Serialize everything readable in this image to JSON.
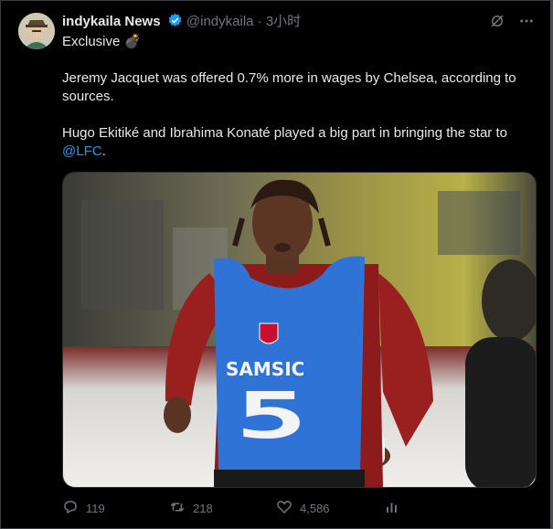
{
  "post": {
    "author_name": "indykaila News",
    "handle": "@indykaila",
    "separator": "·",
    "time": "3小时",
    "lines": [
      "Exclusive 💣",
      "Jeremy Jacquet was offered 0.7% more in wages by Chelsea, according to",
      "sources.",
      "Hugo Ekitiké and Ibrahima Konaté played a big part in bringing the star to"
    ],
    "mention": "@LFC",
    "mention_suffix": ".",
    "image": {
      "jersey_sponsor": "SAMSIC",
      "jersey_number": "5"
    }
  },
  "actions": {
    "replies": "119",
    "reposts": "218",
    "likes": "4,586"
  },
  "icons": {
    "verified": "verified-badge-icon",
    "grok": "grok-icon",
    "more": "more-icon",
    "reply": "reply-icon",
    "repost": "repost-icon",
    "like": "like-icon",
    "views": "views-icon"
  },
  "colors": {
    "background": "#000000",
    "text": "#e7e9ea",
    "muted": "#71767b",
    "accent": "#1d9bf0"
  }
}
